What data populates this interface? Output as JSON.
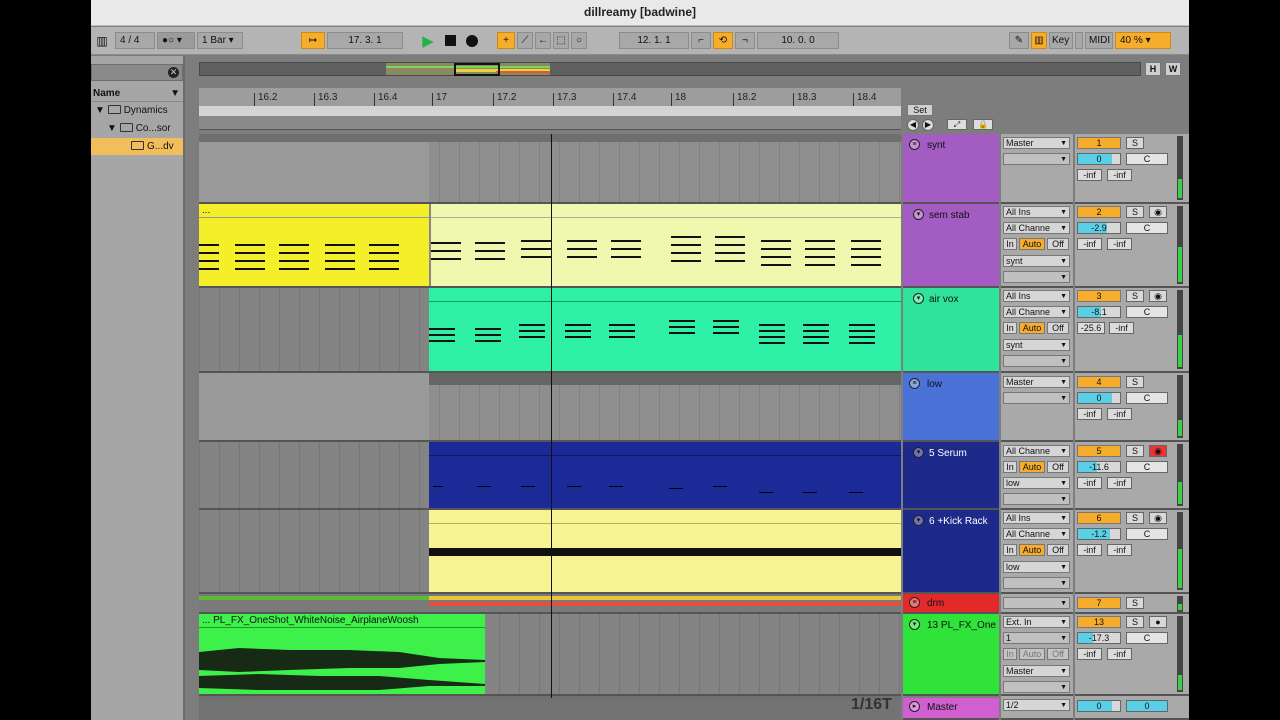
{
  "window": {
    "title": "dillreamy  [badwine]"
  },
  "control_bar": {
    "time_signature": "4 / 4",
    "quantize": "1 Bar",
    "arrangement_position": "17.   3.   1",
    "loop_start": "12.   1.   1",
    "loop_length": "10.   0.   0",
    "key_label": "Key",
    "midi_label": "MIDI",
    "cpu_load": "40 %"
  },
  "browser": {
    "header": "Name",
    "items": [
      {
        "label": "Dynamics",
        "level": 0
      },
      {
        "label": "Co...sor",
        "level": 1
      },
      {
        "label": "G...dv",
        "level": 2,
        "selected": true
      }
    ]
  },
  "overview_buttons": {
    "h": "H",
    "w": "W"
  },
  "ruler": {
    "ticks": [
      "16.2",
      "16.3",
      "16.4",
      "17",
      "17.2",
      "17.3",
      "17.4",
      "18",
      "18.2",
      "18.3",
      "18.4"
    ]
  },
  "set_label": "Set",
  "clips": {
    "sem_stab": "...",
    "pl_fx": "... PL_FX_OneShot_WhiteNoise_AirplaneWoosh"
  },
  "grid_label": "1/16T",
  "tracks": [
    {
      "name": "synt",
      "color": "#a35cc2",
      "output": "Master",
      "number": "1",
      "volume": "0",
      "pan": "C",
      "peak_l": "-inf",
      "peak_r": "-inf"
    },
    {
      "name": "sem stab",
      "color": "#a35cc2",
      "input": "All Ins",
      "channel": "All Channe",
      "out": "synt",
      "number": "2",
      "volume": "-2.9",
      "pan": "C",
      "peak_l": "-inf",
      "peak_r": "-inf"
    },
    {
      "name": "air vox",
      "color": "#2fe39a",
      "input": "All Ins",
      "channel": "All Channe",
      "out": "synt",
      "number": "3",
      "volume": "-8.1",
      "pan": "C",
      "peak_l": "-25.6",
      "peak_r": "-inf"
    },
    {
      "name": "low",
      "color": "#4b72d6",
      "output": "Master",
      "number": "4",
      "volume": "0",
      "pan": "C",
      "peak_l": "-inf",
      "peak_r": "-inf"
    },
    {
      "name": "5 Serum",
      "color": "#1d2a8a",
      "channel": "All Channe",
      "out": "low",
      "number": "5",
      "volume": "-11.6",
      "pan": "C",
      "peak_l": "-inf",
      "peak_r": "-inf"
    },
    {
      "name": "6 +Kick Rack",
      "color": "#1d2a8a",
      "input": "All Ins",
      "channel": "All Channe",
      "out": "low",
      "number": "6",
      "volume": "-1.2",
      "pan": "C",
      "peak_l": "-inf",
      "peak_r": "-inf"
    },
    {
      "name": "drm",
      "color": "#e22a2a",
      "number": "7"
    },
    {
      "name": "13 PL_FX_One",
      "color": "#2fe33a",
      "input": "Ext. In",
      "channel": "1",
      "out": "Master",
      "number": "13",
      "volume": "-17.3",
      "pan": "C",
      "peak_l": "-inf",
      "peak_r": "-inf"
    },
    {
      "name": "Master",
      "color": "#d05fd0",
      "output": "1/2",
      "number": "0",
      "volume": "0"
    }
  ],
  "monitor": {
    "in": "In",
    "auto": "Auto",
    "off": "Off"
  },
  "solo_label": "S"
}
